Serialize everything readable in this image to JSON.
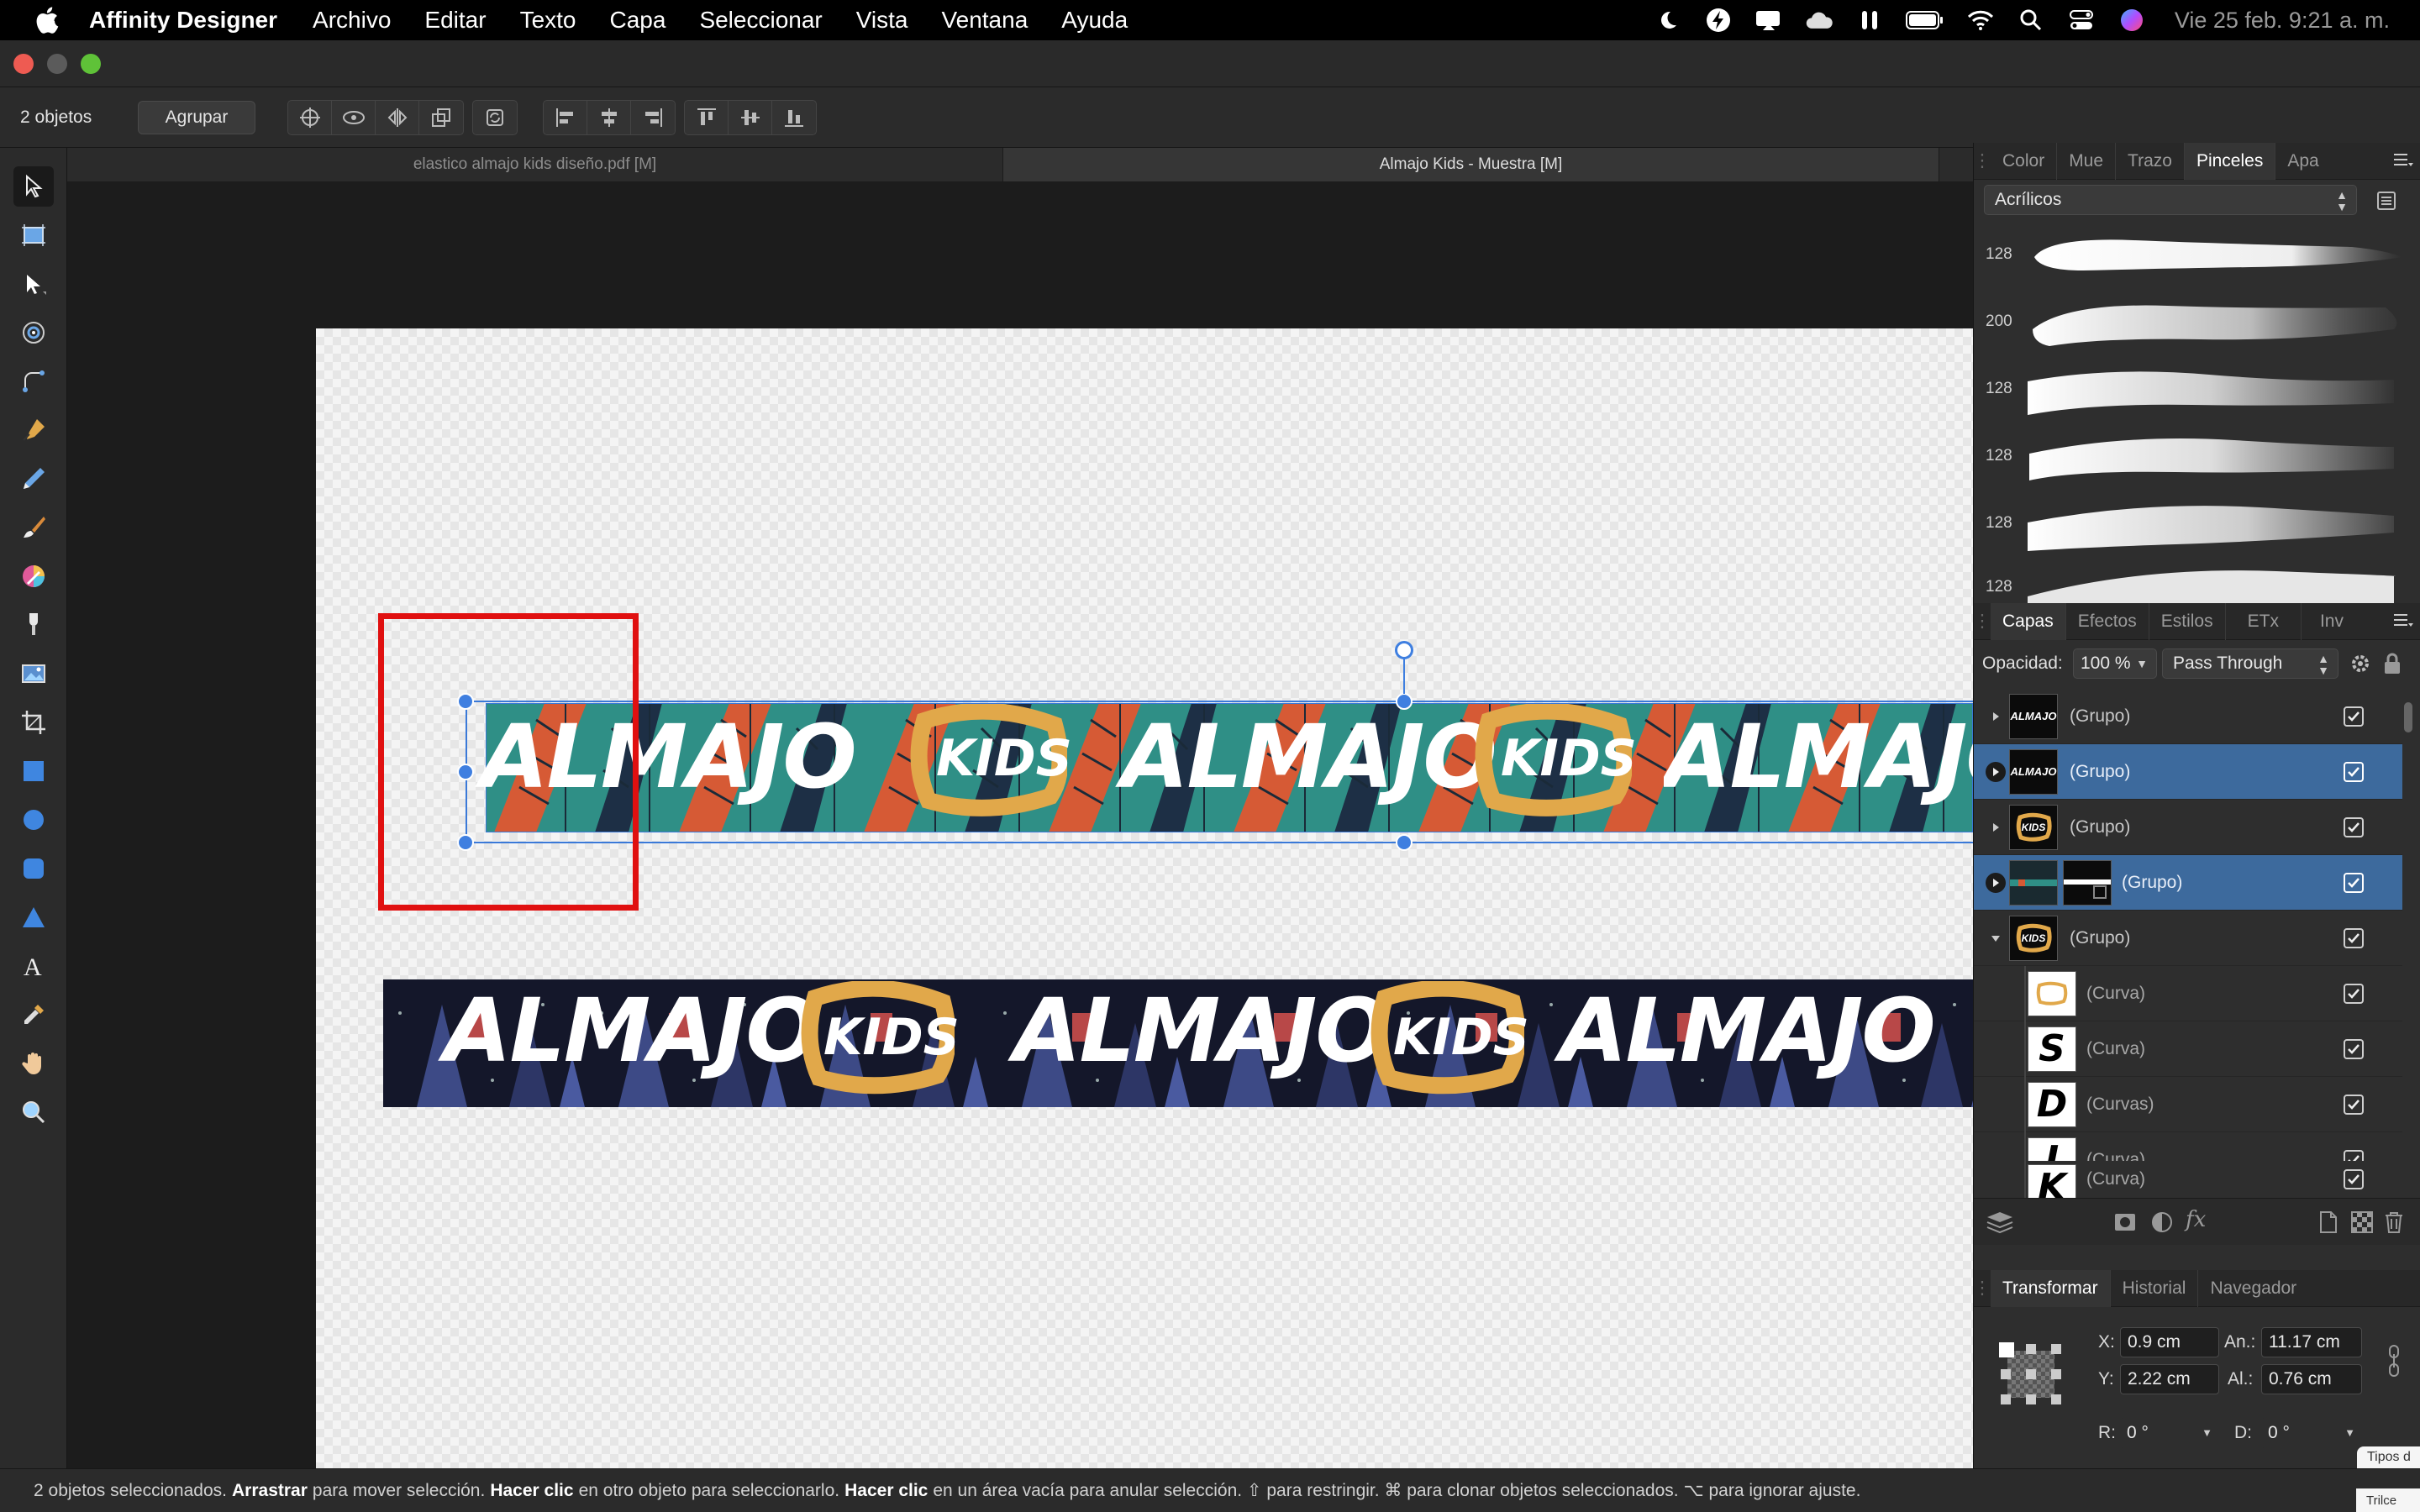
{
  "menubar": {
    "app_name": "Affinity Designer",
    "items": [
      "Archivo",
      "Editar",
      "Texto",
      "Capa",
      "Seleccionar",
      "Vista",
      "Ventana",
      "Ayuda"
    ],
    "clock": "Vie 25 feb.  9:21 a. m."
  },
  "context_toolbar": {
    "selection_count": "2 objetos",
    "group_button": "Agrupar"
  },
  "document_tabs": [
    {
      "label": "elastico almajo kids diseño.pdf [M]",
      "active": false
    },
    {
      "label": "Almajo Kids - Muestra [M]",
      "active": true
    }
  ],
  "artwork": {
    "word_almajo": "ALMAJO",
    "word_kids": "KIDS"
  },
  "brushes_panel": {
    "tabs": [
      "Color",
      "Mue",
      "Trazo",
      "Pinceles",
      "Apa"
    ],
    "active_tab": "Pinceles",
    "category": "Acrílicos",
    "brushes": [
      {
        "size": "128"
      },
      {
        "size": "200"
      },
      {
        "size": "128"
      },
      {
        "size": "128"
      },
      {
        "size": "128"
      },
      {
        "size": "128"
      }
    ]
  },
  "layers_panel": {
    "tabs": [
      "Capas",
      "Efectos",
      "Estilos",
      "ETx",
      "Inv"
    ],
    "active_tab": "Capas",
    "opacity_label": "Opacidad:",
    "opacity_value": "100 %",
    "blend_mode": "Pass Through",
    "layers": [
      {
        "name": "(Grupo)",
        "thumb": "ALMAJO",
        "expanded": false,
        "selected": false,
        "child": false
      },
      {
        "name": "(Grupo)",
        "thumb": "ALMAJO",
        "expanded": false,
        "selected": true,
        "child": false
      },
      {
        "name": "(Grupo)",
        "thumb": "KIDS",
        "expanded": false,
        "selected": false,
        "child": false
      },
      {
        "name": "(Grupo)",
        "thumb": "",
        "expanded": false,
        "selected": true,
        "child": false
      },
      {
        "name": "(Grupo)",
        "thumb": "KIDS",
        "expanded": true,
        "selected": false,
        "child": false
      },
      {
        "name": "(Curva)",
        "thumb": "",
        "expanded": false,
        "selected": false,
        "child": true
      },
      {
        "name": "(Curva)",
        "thumb": "S",
        "expanded": false,
        "selected": false,
        "child": true
      },
      {
        "name": "(Curvas)",
        "thumb": "D",
        "expanded": false,
        "selected": false,
        "child": true
      },
      {
        "name": "(Curva)",
        "thumb": "I",
        "expanded": false,
        "selected": false,
        "child": true
      },
      {
        "name": "(Curva)",
        "thumb": "K",
        "expanded": false,
        "selected": false,
        "child": true
      }
    ]
  },
  "transform_panel": {
    "tabs": [
      "Transformar",
      "Historial",
      "Navegador"
    ],
    "active_tab": "Transformar",
    "x_label": "X:",
    "x_value": "0.9 cm",
    "y_label": "Y:",
    "y_value": "2.22 cm",
    "w_label": "An.:",
    "w_value": "11.17 cm",
    "h_label": "Al.:",
    "h_value": "0.76 cm",
    "r_label": "R:",
    "r_value": "0 °",
    "s_label": "D:",
    "s_value": "0 °"
  },
  "tooltip_fragment": [
    "Tipos d",
    "Trilce"
  ],
  "statusbar": {
    "parts": [
      {
        "text": "2 objetos seleccionados.",
        "bold": false
      },
      {
        "text": "Arrastrar",
        "bold": true
      },
      {
        "text": "para mover selección.",
        "bold": false
      },
      {
        "text": "Hacer clic",
        "bold": true
      },
      {
        "text": "en otro objeto para seleccionarlo.",
        "bold": false
      },
      {
        "text": "Hacer clic",
        "bold": true
      },
      {
        "text": "en un área vacía para anular selección. ⇧ para restringir. ⌘ para clonar objetos seleccionados. ⌥ para ignorar ajuste.",
        "bold": false
      }
    ]
  },
  "colors": {
    "selection_blue": "#3d6a9d",
    "highlight_red": "#e01010",
    "banner_teal": "#2f8f86",
    "banner_orange": "#d65a35",
    "kids_gold": "#e1a84a",
    "banner_dark": "#14172a"
  }
}
